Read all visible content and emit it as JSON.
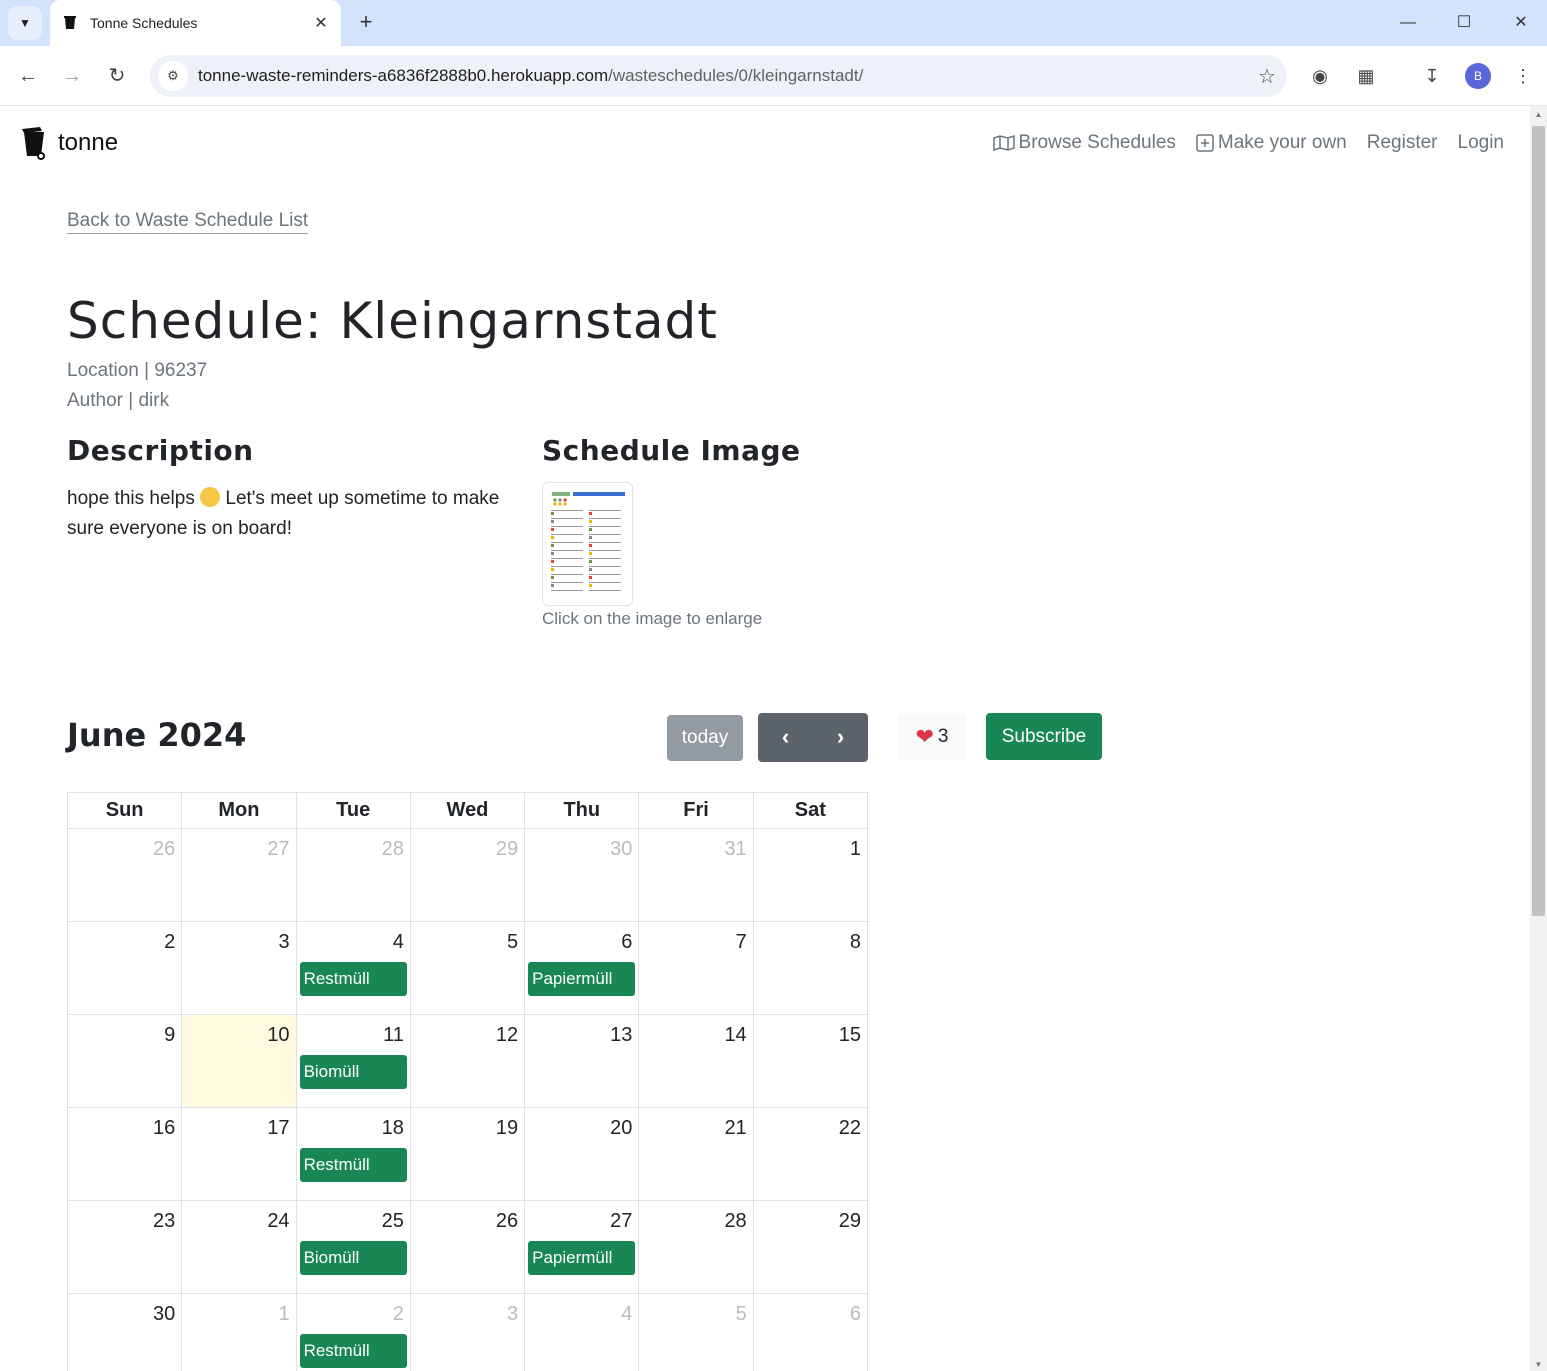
{
  "browser": {
    "tab_title": "Tonne Schedules",
    "url_domain": "tonne-waste-reminders-a6836f2888b0.herokuapp.com",
    "url_path": "/wasteschedules/0/kleingarnstadt/",
    "profile_initial": "B"
  },
  "navbar": {
    "brand": "tonne",
    "items": [
      {
        "label": "Browse Schedules",
        "icon": "map-icon"
      },
      {
        "label": "Make your own",
        "icon": "plus-square-icon"
      },
      {
        "label": "Register"
      },
      {
        "label": "Login"
      }
    ]
  },
  "schedule": {
    "back_link": "Back to Waste Schedule List",
    "title": "Schedule: Kleingarnstadt",
    "location": "Location | 96237",
    "author": "Author | dirk",
    "description_heading": "Description",
    "description_part1": "hope this helps",
    "description_part2": "Let's meet up sometime to make sure everyone is on board!",
    "image_heading": "Schedule Image",
    "image_caption": "Click on the image to enlarge"
  },
  "calendar": {
    "title": "June 2024",
    "today_button": "today",
    "prev_icon": "chevron-left-icon",
    "next_icon": "chevron-right-icon",
    "likes": "3",
    "subscribe_button": "Subscribe",
    "weekdays": [
      "Sun",
      "Mon",
      "Tue",
      "Wed",
      "Thu",
      "Fri",
      "Sat"
    ],
    "event_color": "#198754",
    "today_color": "#fffadf",
    "weeks": [
      [
        {
          "d": "26",
          "o": true
        },
        {
          "d": "27",
          "o": true
        },
        {
          "d": "28",
          "o": true
        },
        {
          "d": "29",
          "o": true
        },
        {
          "d": "30",
          "o": true
        },
        {
          "d": "31",
          "o": true
        },
        {
          "d": "1"
        }
      ],
      [
        {
          "d": "2"
        },
        {
          "d": "3"
        },
        {
          "d": "4",
          "e": "Restmüll"
        },
        {
          "d": "5"
        },
        {
          "d": "6",
          "e": "Papiermüll"
        },
        {
          "d": "7"
        },
        {
          "d": "8"
        }
      ],
      [
        {
          "d": "9"
        },
        {
          "d": "10",
          "t": true
        },
        {
          "d": "11",
          "e": "Biomüll"
        },
        {
          "d": "12"
        },
        {
          "d": "13"
        },
        {
          "d": "14"
        },
        {
          "d": "15"
        }
      ],
      [
        {
          "d": "16"
        },
        {
          "d": "17"
        },
        {
          "d": "18",
          "e": "Restmüll"
        },
        {
          "d": "19"
        },
        {
          "d": "20"
        },
        {
          "d": "21"
        },
        {
          "d": "22"
        }
      ],
      [
        {
          "d": "23"
        },
        {
          "d": "24"
        },
        {
          "d": "25",
          "e": "Biomüll"
        },
        {
          "d": "26"
        },
        {
          "d": "27",
          "e": "Papiermüll"
        },
        {
          "d": "28"
        },
        {
          "d": "29"
        }
      ],
      [
        {
          "d": "30"
        },
        {
          "d": "1",
          "o": true
        },
        {
          "d": "2",
          "o": true,
          "e": "Restmüll"
        },
        {
          "d": "3",
          "o": true
        },
        {
          "d": "4",
          "o": true
        },
        {
          "d": "5",
          "o": true
        },
        {
          "d": "6",
          "o": true
        }
      ]
    ]
  }
}
